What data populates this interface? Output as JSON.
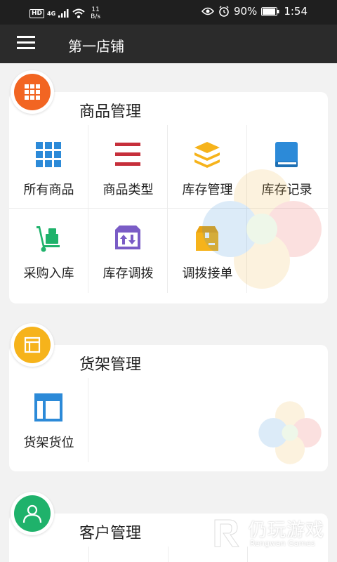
{
  "status_bar": {
    "hd": "HD",
    "network": "4G",
    "speed_value": "11",
    "speed_unit": "B/s",
    "battery": "90%",
    "time": "1:54",
    "icons": [
      "signal-icon",
      "wifi-icon",
      "eye-icon",
      "alarm-icon",
      "battery-icon"
    ]
  },
  "app_bar": {
    "title": "第一店铺",
    "menu_icon": "hamburger-menu-icon"
  },
  "sections": [
    {
      "title": "商品管理",
      "badge_color": "#f26522",
      "items": [
        {
          "label": "所有商品",
          "icon": "grid-icon",
          "color": "#2c8ad8"
        },
        {
          "label": "商品类型",
          "icon": "bars-icon",
          "color": "#c62f3b"
        },
        {
          "label": "库存管理",
          "icon": "layers-icon",
          "color": "#f6b31b"
        },
        {
          "label": "库存记录",
          "icon": "book-icon",
          "color": "#2c8ad8"
        },
        {
          "label": "采购入库",
          "icon": "hand-truck-icon",
          "color": "#1fb26b"
        },
        {
          "label": "库存调拨",
          "icon": "transfer-box-icon",
          "color": "#7a5cc6"
        },
        {
          "label": "调拨接单",
          "icon": "package-icon",
          "color": "#f6b31b"
        }
      ]
    },
    {
      "title": "货架管理",
      "badge_color": "#f6b31b",
      "items": [
        {
          "label": "货架货位",
          "icon": "shelf-layout-icon",
          "color": "#2c8ad8"
        }
      ]
    },
    {
      "title": "客户管理",
      "badge_color": "#1fb26b",
      "items": []
    }
  ],
  "watermark": {
    "name": "仍玩游戏",
    "sub": "Rengwan Games"
  }
}
